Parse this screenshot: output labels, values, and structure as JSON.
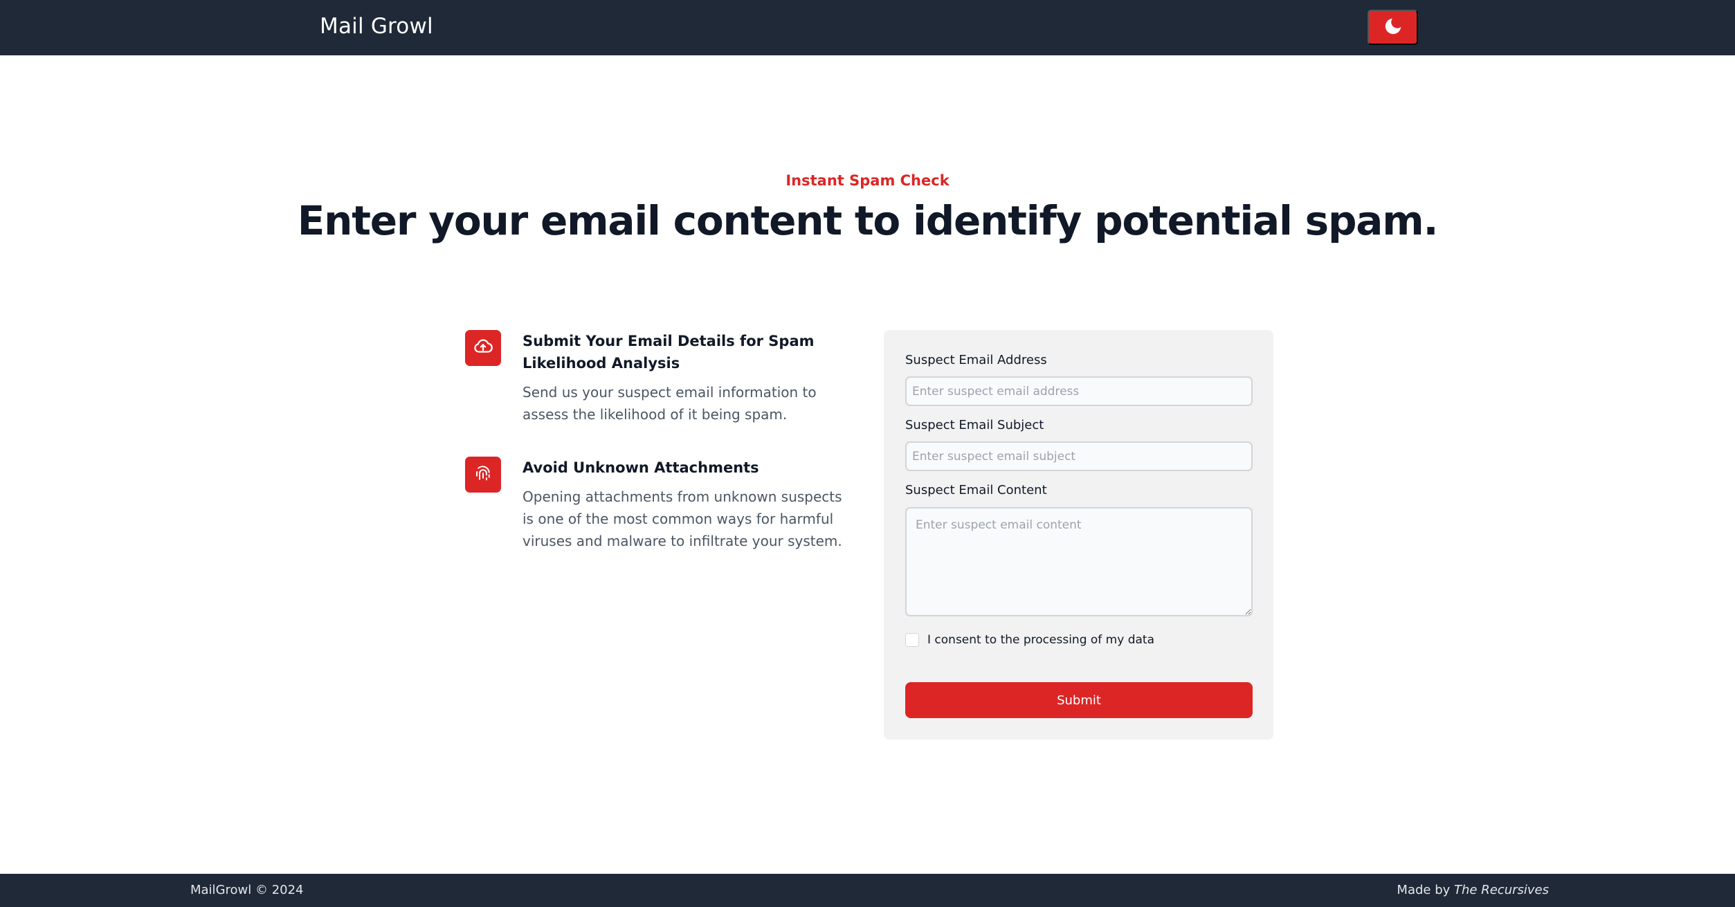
{
  "navbar": {
    "brand": "Mail Growl",
    "theme_toggle_icon": "moon-icon"
  },
  "hero": {
    "eyebrow": "Instant Spam Check",
    "headline": "Enter your email content to identify potential spam."
  },
  "features": [
    {
      "icon": "cloud-upload-icon",
      "title": "Submit Your Email Details for Spam Likelihood Analysis",
      "description": "Send us your suspect email information to assess the likelihood of it being spam."
    },
    {
      "icon": "fingerprint-icon",
      "title": "Avoid Unknown Attachments",
      "description": "Opening attachments from unknown suspects is one of the most common ways for harmful viruses and malware to infiltrate your system."
    }
  ],
  "form": {
    "address_label": "Suspect Email Address",
    "address_placeholder": "Enter suspect email address",
    "address_value": "",
    "subject_label": "Suspect Email Subject",
    "subject_placeholder": "Enter suspect email subject",
    "subject_value": "",
    "content_label": "Suspect Email Content",
    "content_placeholder": "Enter suspect email content",
    "content_value": "",
    "consent_label": "I consent to the processing of my data",
    "consent_checked": false,
    "submit_label": "Submit"
  },
  "footer": {
    "copyright": "MailGrowl © 2024",
    "made_by_prefix": "Made by",
    "made_by_name": "The Recursives"
  },
  "colors": {
    "accent": "#dc2626",
    "navbar_bg": "#1f2937",
    "card_bg": "#f2f2f2"
  }
}
